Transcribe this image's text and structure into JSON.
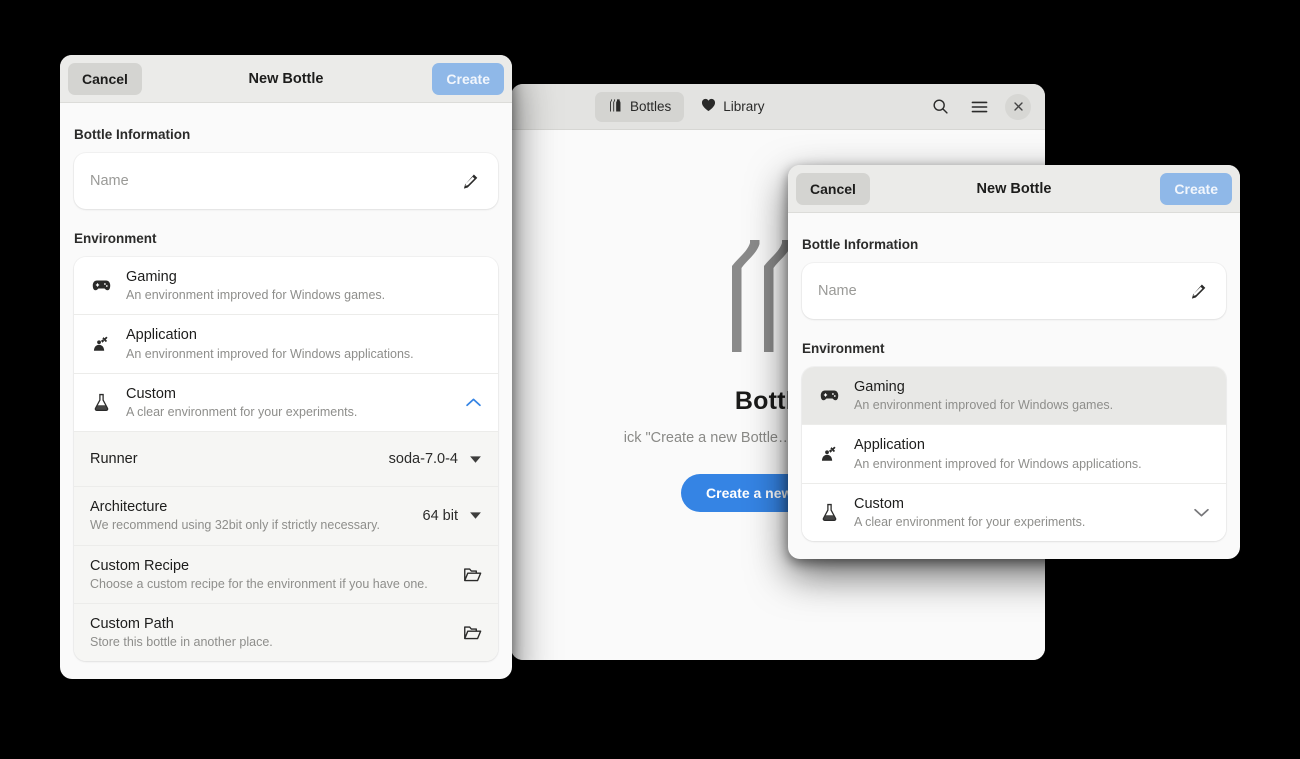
{
  "main_window": {
    "headerbar": {
      "tabs": [
        {
          "label": "Bottles",
          "icon": "bottles-icon",
          "active": true
        },
        {
          "label": "Library",
          "icon": "heart-icon",
          "active": false
        }
      ],
      "actions": [
        {
          "name": "search-icon",
          "label": "Search"
        },
        {
          "name": "hamburger-menu-icon",
          "label": "Main Menu"
        },
        {
          "name": "close-icon",
          "label": "Close"
        }
      ]
    },
    "empty_state": {
      "icon": "bottles-logo-icon",
      "title": "Bottles",
      "subtitle": "ick \"Create a new Bottle…\" to create a new bottl",
      "button_label": "Create a new Bottle…"
    }
  },
  "dialog_front": {
    "headerbar": {
      "cancel_label": "Cancel",
      "title": "New Bottle",
      "create_label": "Create"
    },
    "bottle_information": {
      "group_title": "Bottle Information",
      "name_placeholder": "Name",
      "name_value": "",
      "edit_icon": "pencil-icon"
    },
    "environment": {
      "group_title": "Environment",
      "options": [
        {
          "icon": "gamepad-icon",
          "title": "Gaming",
          "subtitle": "An environment improved for Windows games.",
          "selected": false,
          "end": "none"
        },
        {
          "icon": "application-icon",
          "title": "Application",
          "subtitle": "An environment improved for Windows applications.",
          "selected": false,
          "end": "none"
        },
        {
          "icon": "flask-icon",
          "title": "Custom",
          "subtitle": "A clear environment for your experiments.",
          "selected": false,
          "end": "chevron-up-blue"
        }
      ],
      "expanded_rows": [
        {
          "title": "Runner",
          "subtitle": "",
          "value": "soda-7.0-4",
          "end": "dropdown-triangle"
        },
        {
          "title": "Architecture",
          "subtitle": "We recommend using 32bit only if strictly necessary.",
          "value": "64 bit",
          "end": "dropdown-triangle"
        },
        {
          "title": "Custom Recipe",
          "subtitle": "Choose a custom recipe for the environment if you have one.",
          "value": "",
          "end": "folder-open-icon"
        },
        {
          "title": "Custom Path",
          "subtitle": "Store this bottle in another place.",
          "value": "",
          "end": "folder-open-icon"
        }
      ]
    }
  },
  "dialog_back": {
    "headerbar": {
      "cancel_label": "Cancel",
      "title": "New Bottle",
      "create_label": "Create"
    },
    "bottle_information": {
      "group_title": "Bottle Information",
      "name_placeholder": "Name",
      "name_value": "",
      "edit_icon": "pencil-icon"
    },
    "environment": {
      "group_title": "Environment",
      "options": [
        {
          "icon": "gamepad-icon",
          "title": "Gaming",
          "subtitle": "An environment improved for Windows games.",
          "selected": true,
          "end": "none"
        },
        {
          "icon": "application-icon",
          "title": "Application",
          "subtitle": "An environment improved for Windows applications.",
          "selected": false,
          "end": "none"
        },
        {
          "icon": "flask-icon",
          "title": "Custom",
          "subtitle": "A clear environment for your experiments.",
          "selected": false,
          "end": "chevron-down-gray"
        }
      ]
    }
  },
  "colors": {
    "accent_blue": "#3584e4",
    "create_disabled_blue": "#8fb8e8",
    "headerbar_gray": "#e3e3e1",
    "dialog_header_gray": "#ebebe9",
    "page_bg": "#fafafa",
    "selected_row": "#e8e8e6",
    "empty_icon_gray": "#8a8a8a"
  }
}
